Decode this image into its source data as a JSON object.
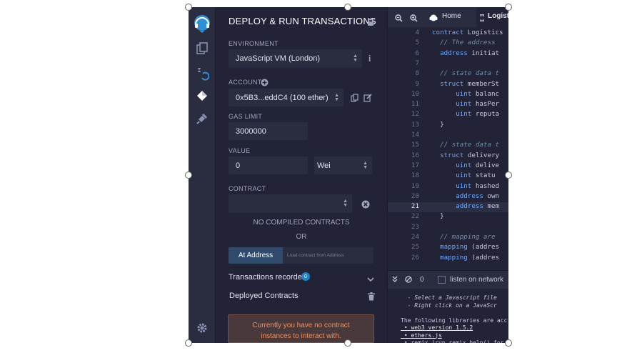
{
  "panel": {
    "title": "DEPLOY & RUN TRANSACTIONS",
    "environment_label": "ENVIRONMENT",
    "environment_value": "JavaScript VM (London)",
    "account_label": "ACCOUNT",
    "account_value": "0x5B3...eddC4 (100 ether)",
    "gas_limit_label": "GAS LIMIT",
    "gas_limit_value": "3000000",
    "value_label": "VALUE",
    "value_amount": "0",
    "value_unit": "Wei",
    "contract_label": "CONTRACT",
    "contract_value": "",
    "no_compiled": "NO COMPILED CONTRACTS",
    "or": "OR",
    "at_address_button": "At Address",
    "load_contract_placeholder": "Load contract from Address",
    "transactions_recorded_label": "Transactions recorded",
    "transactions_recorded_count": "0",
    "deployed_contracts_label": "Deployed Contracts",
    "notice_line1": "Currently you have no contract",
    "notice_line2": "instances to interact with."
  },
  "editor": {
    "tabs": {
      "home": "Home",
      "file": "Logisti"
    },
    "lines": [
      {
        "n": "4",
        "parts": [
          [
            "kw",
            "contract"
          ],
          [
            "",
            " Logistics"
          ]
        ]
      },
      {
        "n": "5",
        "parts": [
          [
            "cm",
            "  // The address"
          ]
        ]
      },
      {
        "n": "6",
        "parts": [
          [
            "kw",
            "  address"
          ],
          [
            "",
            " initiat"
          ]
        ]
      },
      {
        "n": "7",
        "parts": []
      },
      {
        "n": "8",
        "parts": [
          [
            "cm",
            "  // state data t"
          ]
        ]
      },
      {
        "n": "9",
        "parts": [
          [
            "kw",
            "  struct"
          ],
          [
            "",
            " memberSt"
          ]
        ]
      },
      {
        "n": "10",
        "parts": [
          [
            "kw",
            "      uint"
          ],
          [
            "",
            " balanc"
          ]
        ]
      },
      {
        "n": "11",
        "parts": [
          [
            "kw",
            "      uint"
          ],
          [
            "",
            " hasPer"
          ]
        ]
      },
      {
        "n": "12",
        "parts": [
          [
            "kw",
            "      uint"
          ],
          [
            "",
            " reputa"
          ]
        ]
      },
      {
        "n": "13",
        "parts": [
          [
            "",
            "  }"
          ]
        ]
      },
      {
        "n": "14",
        "parts": []
      },
      {
        "n": "15",
        "parts": [
          [
            "cm",
            "  // state data t"
          ]
        ]
      },
      {
        "n": "16",
        "parts": [
          [
            "kw",
            "  struct"
          ],
          [
            "",
            " delivery"
          ]
        ]
      },
      {
        "n": "17",
        "parts": [
          [
            "kw",
            "      uint"
          ],
          [
            "",
            " delive"
          ]
        ]
      },
      {
        "n": "18",
        "parts": [
          [
            "kw",
            "      uint"
          ],
          [
            "",
            " statu"
          ]
        ]
      },
      {
        "n": "19",
        "parts": [
          [
            "kw",
            "      uint"
          ],
          [
            "",
            " hashed"
          ]
        ]
      },
      {
        "n": "20",
        "parts": [
          [
            "kw",
            "      address"
          ],
          [
            "",
            " own"
          ]
        ]
      },
      {
        "n": "21",
        "parts": [
          [
            "kw",
            "      address"
          ],
          [
            "",
            " mem"
          ]
        ],
        "active": true
      },
      {
        "n": "22",
        "parts": [
          [
            "",
            "  }"
          ]
        ]
      },
      {
        "n": "23",
        "parts": []
      },
      {
        "n": "24",
        "parts": [
          [
            "cm",
            "  // mapping are"
          ]
        ]
      },
      {
        "n": "25",
        "parts": [
          [
            "kw",
            "  mapping"
          ],
          [
            "",
            " (addres"
          ]
        ]
      },
      {
        "n": "26",
        "parts": [
          [
            "kw",
            "  mapping"
          ],
          [
            "",
            " (addres"
          ]
        ]
      }
    ]
  },
  "terminal": {
    "count": "0",
    "listen_label": "listen on network",
    "lines": [
      {
        "text": "  - Select a Javascript file",
        "style": "it"
      },
      {
        "text": "  - Right click on a JavaScr",
        "style": "it"
      },
      {
        "text": "",
        "style": ""
      },
      {
        "text": "The following libraries are acc",
        "style": ""
      },
      {
        "text": " • web3 version 1.5.2",
        "style": "link"
      },
      {
        "text": " • ethers.js",
        "style": "link"
      },
      {
        "text": " • remix (run remix.help() for",
        "style": ""
      }
    ]
  },
  "icons": {
    "iconbar": [
      "remix-logo-icon",
      "file-explorer-icon",
      "solidity-compiler-icon",
      "deploy-run-icon",
      "plugin-manager-icon",
      "settings-icon"
    ],
    "tabs": [
      "zoom-out-icon",
      "zoom-in-icon",
      "home-icon",
      "solidity-file-icon"
    ]
  },
  "colors": {
    "panel_bg": "#222336",
    "iconbar_bg": "#2a2c3f",
    "accent": "#1e86c4",
    "notice_text": "#f08f5f"
  }
}
